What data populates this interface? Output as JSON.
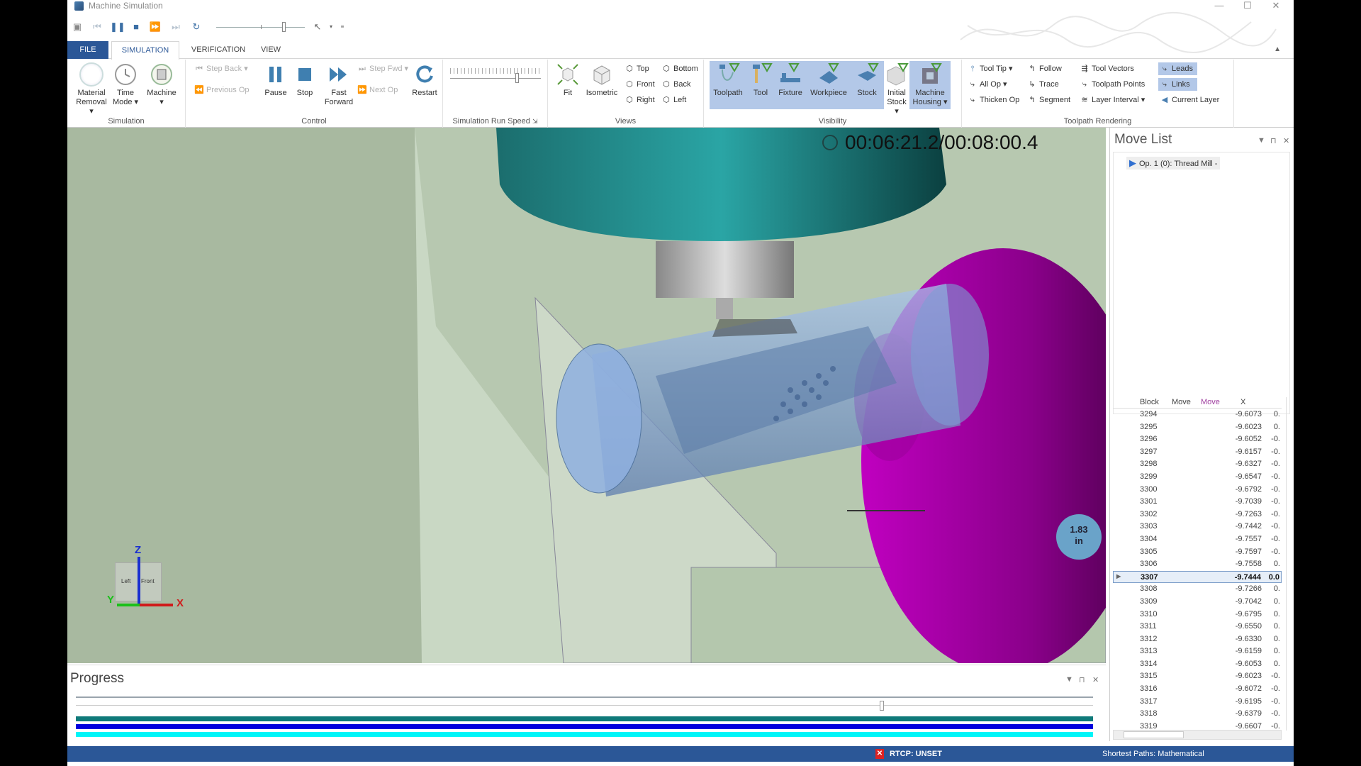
{
  "window": {
    "title": "Machine Simulation",
    "minimize": "—",
    "maximize": "☐",
    "close": "✕"
  },
  "qat": {
    "icons": [
      "save-icon",
      "skip-start-icon",
      "pause-icon",
      "stop-icon",
      "fast-forward-icon",
      "skip-end-icon",
      "restart-icon",
      "pointer-icon"
    ]
  },
  "tabs": [
    {
      "label": "FILE"
    },
    {
      "label": "SIMULATION",
      "active": true
    },
    {
      "label": "VERIFICATION"
    },
    {
      "label": "VIEW"
    }
  ],
  "ribbon": {
    "simulation": {
      "label": "Simulation",
      "material_removal": "Material\nRemoval ▾",
      "time_mode": "Time\nMode ▾",
      "machine": "Machine\n▾"
    },
    "control": {
      "label": "Control",
      "step_back": "Step Back ▾",
      "previous_op": "Previous Op",
      "pause": "Pause",
      "stop": "Stop",
      "fast_forward": "Fast\nForward",
      "step_fwd": "Step Fwd ▾",
      "next_op": "Next Op",
      "restart": "Restart"
    },
    "speed": {
      "label": "Simulation Run Speed",
      "value_fraction": 0.72
    },
    "views": {
      "label": "Views",
      "fit": "Fit",
      "isometric": "Isometric",
      "top": "Top",
      "front": "Front",
      "right": "Right",
      "bottom": "Bottom",
      "back": "Back",
      "left": "Left"
    },
    "visibility": {
      "label": "Visibility",
      "toolpath": "Toolpath",
      "tool": "Tool",
      "fixture": "Fixture",
      "workpiece": "Workpiece",
      "stock": "Stock",
      "initial_stock": "Initial\nStock ▾",
      "machine_housing": "Machine\nHousing ▾"
    },
    "toolpath_rendering": {
      "label": "Toolpath Rendering",
      "tool_tip": "Tool Tip ▾",
      "all_op": "All Op ▾",
      "thicken_op": "Thicken Op",
      "follow": "Follow",
      "trace": "Trace",
      "segment": "Segment",
      "tool_vectors": "Tool Vectors",
      "toolpath_points": "Toolpath Points",
      "layer_interval": "Layer Interval ▾",
      "leads": "Leads",
      "links": "Links",
      "current_layer": "Current Layer"
    }
  },
  "viewport": {
    "timer": "00:06:21.2/00:08:00.4",
    "triad": {
      "z": "Z",
      "x": "X",
      "y": "Y",
      "left": "Left",
      "front": "Front"
    },
    "measure": {
      "value": "1.83",
      "unit": "in"
    }
  },
  "progress": {
    "title": "Progress",
    "slider_fraction": 0.79,
    "colors": {
      "bar1": "#0f7a7a",
      "bar2": "#0000dd",
      "bar3": "#00f5f8"
    }
  },
  "movelist": {
    "title": "Move List",
    "tree": [
      {
        "label": "Op. 1 (0): Thread Mill -"
      }
    ],
    "columns": [
      "Block",
      "Move",
      "Move",
      "X"
    ],
    "selected_block": "3307",
    "rows": [
      {
        "block": "3294",
        "x": "-9.6073",
        "y": "0."
      },
      {
        "block": "3295",
        "x": "-9.6023",
        "y": "0."
      },
      {
        "block": "3296",
        "x": "-9.6052",
        "y": "-0."
      },
      {
        "block": "3297",
        "x": "-9.6157",
        "y": "-0."
      },
      {
        "block": "3298",
        "x": "-9.6327",
        "y": "-0."
      },
      {
        "block": "3299",
        "x": "-9.6547",
        "y": "-0."
      },
      {
        "block": "3300",
        "x": "-9.6792",
        "y": "-0."
      },
      {
        "block": "3301",
        "x": "-9.7039",
        "y": "-0."
      },
      {
        "block": "3302",
        "x": "-9.7263",
        "y": "-0."
      },
      {
        "block": "3303",
        "x": "-9.7442",
        "y": "-0."
      },
      {
        "block": "3304",
        "x": "-9.7557",
        "y": "-0."
      },
      {
        "block": "3305",
        "x": "-9.7597",
        "y": "-0."
      },
      {
        "block": "3306",
        "x": "-9.7558",
        "y": "0."
      },
      {
        "block": "3307",
        "x": "-9.7444",
        "y": "0.0"
      },
      {
        "block": "3308",
        "x": "-9.7266",
        "y": "0."
      },
      {
        "block": "3309",
        "x": "-9.7042",
        "y": "0."
      },
      {
        "block": "3310",
        "x": "-9.6795",
        "y": "0."
      },
      {
        "block": "3311",
        "x": "-9.6550",
        "y": "0."
      },
      {
        "block": "3312",
        "x": "-9.6330",
        "y": "0."
      },
      {
        "block": "3313",
        "x": "-9.6159",
        "y": "0."
      },
      {
        "block": "3314",
        "x": "-9.6053",
        "y": "0."
      },
      {
        "block": "3315",
        "x": "-9.6023",
        "y": "-0."
      },
      {
        "block": "3316",
        "x": "-9.6072",
        "y": "-0."
      },
      {
        "block": "3317",
        "x": "-9.6195",
        "y": "-0."
      },
      {
        "block": "3318",
        "x": "-9.6379",
        "y": "-0."
      },
      {
        "block": "3319",
        "x": "-9.6607",
        "y": "-0."
      }
    ]
  },
  "status": {
    "rtcp_icon": "✕",
    "rtcp": "RTCP: UNSET",
    "shortest_paths": "Shortest Paths: Mathematical"
  }
}
